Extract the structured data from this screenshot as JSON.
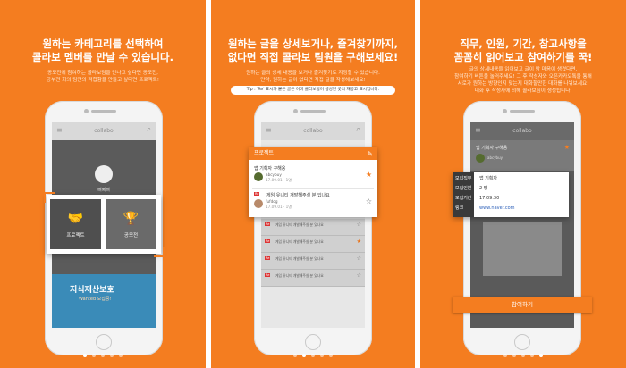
{
  "panel1": {
    "title": [
      "원하는 카테고리를 선택하여",
      "콜라보 멤버를 만날 수 있습니다."
    ],
    "subtitle": [
      "공모전에 참여하는 콜라보팀을 만나고 싶다면 공모전,",
      "공부전 회의 팀만의 적합함을 만들고 싶다면 프로젝트!"
    ],
    "app_logo": "collabo",
    "profile_name": "삐삐삐",
    "tiles": [
      "프로젝트",
      "공모전"
    ],
    "banner_title": "지식재산보호",
    "banner_sub": "Wanted 모집중!"
  },
  "panel2": {
    "title": [
      "원하는 글을 상세보거나, 즐겨찾기까지,",
      "없다면 직접 콜라보 팀원을 구해보세요!"
    ],
    "subtitle": [
      "원하는 글의 상세 내용을 보거나 즐겨찾기로 지정할 수 있습니다.",
      "만약, 원하는 글이 없다면 직접 글을 작성해보세요!"
    ],
    "tip": "Tip : 'Re' 표시가 붙은 글은 이미 콜라보팀이 생성된 곳의 재공고 표시입니다.",
    "app_logo": "collabo",
    "card_header": "프로젝트",
    "card_rows": [
      {
        "title": "앱 기획자 구해용",
        "name": "abcybuy",
        "meta": "17.09.01 · 1명",
        "star": "★"
      },
      {
        "badge": "Re",
        "title": "게임 유니티 개발해주실 분 있나요",
        "name": "fufdog",
        "meta": "17.09.01 · 1명",
        "star": "☆"
      }
    ],
    "list_rows": [
      {
        "badge": "Re",
        "title": "게임 유니티 개발해주실 분 있나요",
        "star": "☆"
      },
      {
        "badge": "Re",
        "title": "게임 유니티 개발해주실 분 있나요",
        "star": "★"
      },
      {
        "badge": "Re",
        "title": "게임 유니티 개발해주실 분 있나요",
        "star": "☆"
      },
      {
        "badge": "Re",
        "title": "게임 유니티 개발해주실 분 있나요",
        "star": "☆"
      }
    ]
  },
  "panel3": {
    "title": [
      "직무, 인원, 기간, 참고사항을",
      "꼼꼼히 읽어보고 참여하기를 꾹!"
    ],
    "subtitle": [
      "글의 상세내용을 읽어보고 글이 맘 마음이 생겼다면,",
      "참여하기 버튼을 눌러주세요! 그 후 작성자와 오픈카카오톡을 통해",
      "서로가 원하는 방향인지 맞는지 대화할만한 대화를 나눠보세요!",
      "대화 후 작성자에 의해 콜라보팀이 생성됩니다."
    ],
    "app_logo": "collabo",
    "post_title": "앱 기획자 구해용",
    "post_author": "abcybuy",
    "detail": [
      {
        "key": "모집직무",
        "value": "앱 기획자"
      },
      {
        "key": "모집인원",
        "value": "2 명"
      },
      {
        "key": "모집기간",
        "value": "17.09.30"
      },
      {
        "key": "링크",
        "value": "www.naver.com"
      }
    ],
    "apply_button": "참여하기"
  },
  "page_dots": {
    "count": 5,
    "active": [
      0,
      1,
      4
    ]
  },
  "colors": {
    "accent": "#f47d20",
    "white": "#ffffff"
  }
}
